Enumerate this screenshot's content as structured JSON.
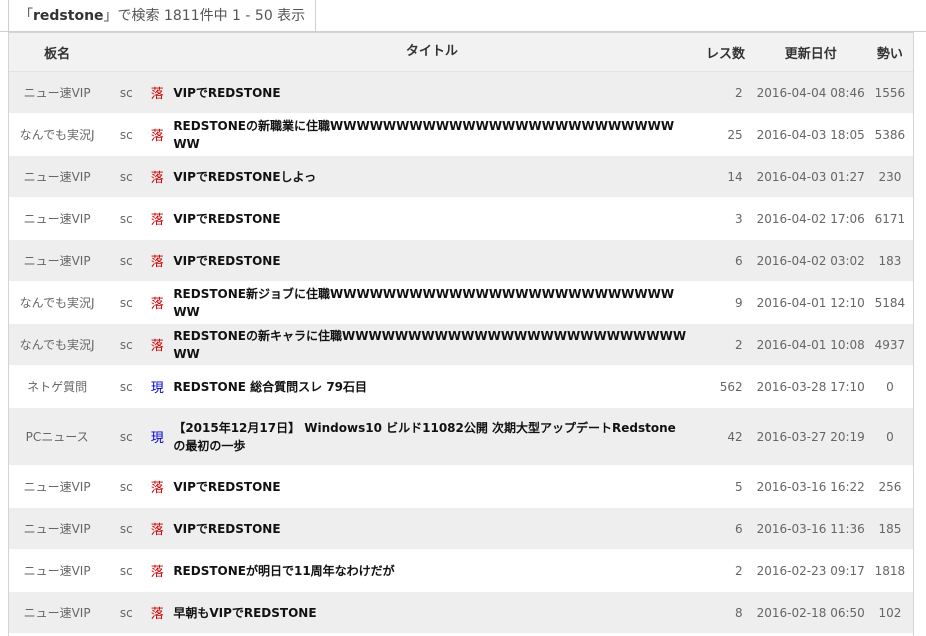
{
  "search": {
    "open_quote": "「",
    "query": "redstone",
    "summary": "」で検索 1811件中 1 - 50 表示"
  },
  "table": {
    "headers": {
      "board": "板名",
      "title": "タイトル",
      "res": "レス数",
      "updated": "更新日付",
      "speed": "勢い"
    },
    "colors": {
      "ochi": "#cc0000",
      "gen": "#0000cc",
      "odd_row": "#eeeeee"
    },
    "rows": [
      {
        "board": "ニュー速VIP",
        "src": "sc",
        "status": "落",
        "title": "VIPでREDSTONE",
        "res": "2",
        "date": "2016-04-04 08:46",
        "speed": "1556"
      },
      {
        "board": "なんでも実況J",
        "src": "sc",
        "status": "落",
        "title": "REDSTONEの新職業に住職WWWWWWWWWWWWWWWWWWWWWWWWWWWW",
        "res": "25",
        "date": "2016-04-03 18:05",
        "speed": "5386"
      },
      {
        "board": "ニュー速VIP",
        "src": "sc",
        "status": "落",
        "title": "VIPでREDSTONEしよっ",
        "res": "14",
        "date": "2016-04-03 01:27",
        "speed": "230"
      },
      {
        "board": "ニュー速VIP",
        "src": "sc",
        "status": "落",
        "title": "VIPでREDSTONE",
        "res": "3",
        "date": "2016-04-02 17:06",
        "speed": "6171"
      },
      {
        "board": "ニュー速VIP",
        "src": "sc",
        "status": "落",
        "title": "VIPでREDSTONE",
        "res": "6",
        "date": "2016-04-02 03:02",
        "speed": "183"
      },
      {
        "board": "なんでも実況J",
        "src": "sc",
        "status": "落",
        "title": "REDSTONE新ジョブに住職WWWWWWWWWWWWWWWWWWWWWWWWWWWW",
        "res": "9",
        "date": "2016-04-01 12:10",
        "speed": "5184"
      },
      {
        "board": "なんでも実況J",
        "src": "sc",
        "status": "落",
        "title": "REDSTONEの新キャラに住職WWWWWWWWWWWWWWWWWWWWWWWWWWWW",
        "res": "2",
        "date": "2016-04-01 10:08",
        "speed": "4937"
      },
      {
        "board": "ネトゲ質問",
        "src": "sc",
        "status": "現",
        "title": "REDSTONE 総合質問スレ 79石目",
        "res": "562",
        "date": "2016-03-28 17:10",
        "speed": "0"
      },
      {
        "board": "PCニュース",
        "src": "sc",
        "status": "現",
        "title": "【2015年12月17日】 Windows10 ビルド11082公開 次期大型アップデートRedstoneの最初の一歩",
        "res": "42",
        "date": "2016-03-27 20:19",
        "speed": "0"
      },
      {
        "board": "ニュー速VIP",
        "src": "sc",
        "status": "落",
        "title": "VIPでREDSTONE",
        "res": "5",
        "date": "2016-03-16 16:22",
        "speed": "256"
      },
      {
        "board": "ニュー速VIP",
        "src": "sc",
        "status": "落",
        "title": "VIPでREDSTONE",
        "res": "6",
        "date": "2016-03-16 11:36",
        "speed": "185"
      },
      {
        "board": "ニュー速VIP",
        "src": "sc",
        "status": "落",
        "title": "REDSTONEが明日で11周年なわけだが",
        "res": "2",
        "date": "2016-02-23 09:17",
        "speed": "1818"
      },
      {
        "board": "ニュー速VIP",
        "src": "sc",
        "status": "落",
        "title": "早朝もVIPでREDSTONE",
        "res": "8",
        "date": "2016-02-18 06:50",
        "speed": "102"
      }
    ]
  }
}
